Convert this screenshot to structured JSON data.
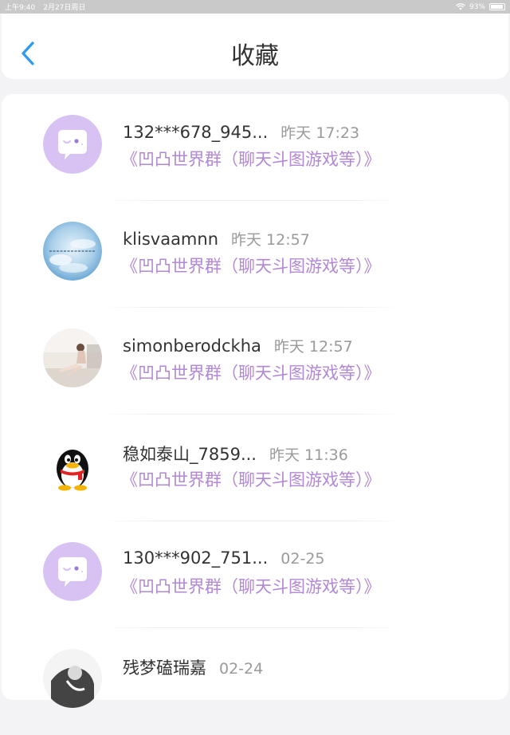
{
  "status_bar": {
    "time": "上午9:40",
    "date": "2月27日周日",
    "battery": "93%",
    "battery_level": 0.93,
    "wifi_icon": "wifi-icon"
  },
  "header": {
    "title": "收藏",
    "back_icon": "chevron-left-icon"
  },
  "colors": {
    "accent": "#2a9af3",
    "purple": "#b288d6",
    "avatar_purple": "#d8c2f3"
  },
  "items": [
    {
      "name": "132***678_945...",
      "time": "昨天 17:23",
      "group": "《凹凸世界群（聊天斗图游戏等）》",
      "avatar": "chat-bubble-avatar"
    },
    {
      "name": "klisvaamnn",
      "time": "昨天 12:57",
      "group": "《凹凸世界群（聊天斗图游戏等）》",
      "avatar": "sky-clouds-avatar"
    },
    {
      "name": "simonberodckha",
      "time": "昨天 12:57",
      "group": "《凹凸世界群（聊天斗图游戏等）》",
      "avatar": "photo-person-avatar"
    },
    {
      "name": "稳如泰山_7859...",
      "time": "昨天 11:36",
      "group": "《凹凸世界群（聊天斗图游戏等）》",
      "avatar": "penguin-avatar"
    },
    {
      "name": "130***902_751...",
      "time": "02-25",
      "group": "《凹凸世界群（聊天斗图游戏等）》",
      "avatar": "chat-bubble-avatar"
    },
    {
      "name": "残梦磕瑞嘉",
      "time": "02-24",
      "group": "",
      "avatar": "photo-bw-avatar"
    }
  ]
}
